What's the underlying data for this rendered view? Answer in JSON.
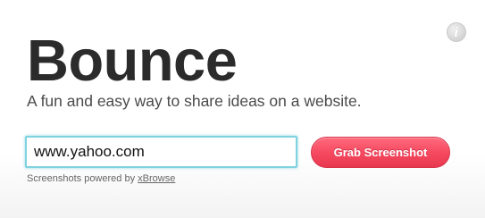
{
  "header": {
    "info_icon": "info-icon",
    "info_glyph": "i"
  },
  "hero": {
    "title": "Bounce",
    "subtitle": "A fun and easy way to share ideas on a website."
  },
  "form": {
    "url_value": "www.yahoo.com",
    "grab_button_label": "Grab Screenshot"
  },
  "footer": {
    "powered_by_text": "Screenshots powered by ",
    "powered_by_link": "xBrowse"
  },
  "colors": {
    "button": "#f64a61",
    "input_focus_border": "#7fd2df",
    "title": "#2b2b2b"
  }
}
